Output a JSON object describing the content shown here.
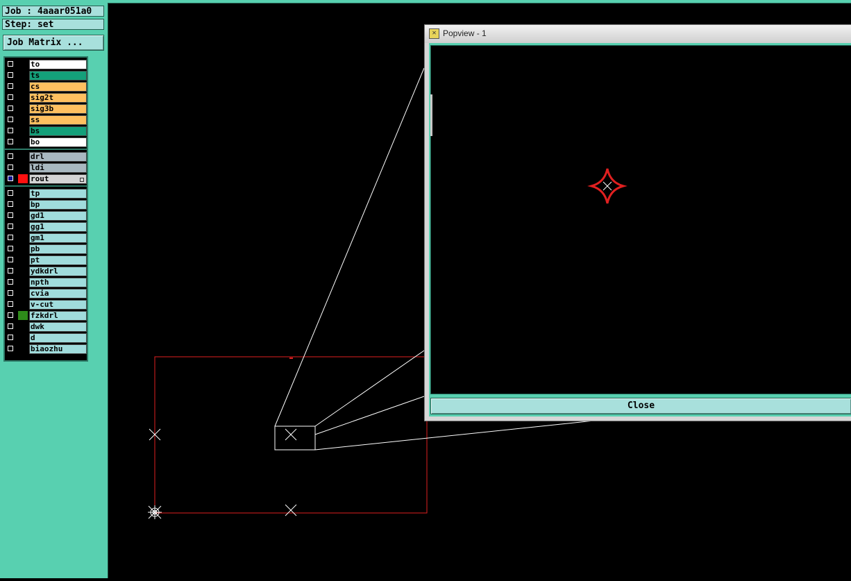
{
  "job_label": "Job : 4aaar051a0",
  "step_label": "Step: set",
  "job_matrix_button": "Job Matrix ...",
  "layer_groups": [
    [
      {
        "name": "to",
        "color": "#ffffff",
        "swatch": null,
        "selected": false
      },
      {
        "name": "ts",
        "color": "#14a07a",
        "swatch": null,
        "selected": false
      },
      {
        "name": "cs",
        "color": "#ffc060",
        "swatch": null,
        "selected": false
      },
      {
        "name": "sig2t",
        "color": "#ffc060",
        "swatch": null,
        "selected": false
      },
      {
        "name": "sig3b",
        "color": "#ffc060",
        "swatch": null,
        "selected": false
      },
      {
        "name": "ss",
        "color": "#ffc060",
        "swatch": null,
        "selected": false
      },
      {
        "name": "bs",
        "color": "#14a07a",
        "swatch": null,
        "selected": false
      },
      {
        "name": "bo",
        "color": "#ffffff",
        "swatch": null,
        "selected": false
      }
    ],
    [
      {
        "name": "drl",
        "color": "#a8b8c0",
        "swatch": null,
        "selected": false
      },
      {
        "name": "ldi",
        "color": "#a8b8c0",
        "swatch": null,
        "selected": false
      },
      {
        "name": "rout",
        "color": "#d4d4d4",
        "swatch": "#ff1010",
        "selected": true,
        "dot": true
      }
    ],
    [
      {
        "name": "tp",
        "color": "#a0dcdc",
        "swatch": null,
        "selected": false
      },
      {
        "name": "bp",
        "color": "#a0dcdc",
        "swatch": null,
        "selected": false
      },
      {
        "name": "gd1",
        "color": "#a0dcdc",
        "swatch": null,
        "selected": false
      },
      {
        "name": "gg1",
        "color": "#a0dcdc",
        "swatch": null,
        "selected": false
      },
      {
        "name": "gm1",
        "color": "#a0dcdc",
        "swatch": null,
        "selected": false
      },
      {
        "name": "pb",
        "color": "#a0dcdc",
        "swatch": null,
        "selected": false
      },
      {
        "name": "pt",
        "color": "#a0dcdc",
        "swatch": null,
        "selected": false
      },
      {
        "name": "ydkdrl",
        "color": "#a0dcdc",
        "swatch": null,
        "selected": false
      },
      {
        "name": "npth",
        "color": "#a0dcdc",
        "swatch": null,
        "selected": false
      },
      {
        "name": "cvia",
        "color": "#a0dcdc",
        "swatch": null,
        "selected": false
      },
      {
        "name": "v-cut",
        "color": "#a0dcdc",
        "swatch": null,
        "selected": false
      },
      {
        "name": "fzkdrl",
        "color": "#a0dcdc",
        "swatch": "#2e8b1a",
        "selected": false
      },
      {
        "name": "dwk",
        "color": "#a0dcdc",
        "swatch": null,
        "selected": false
      },
      {
        "name": "d",
        "color": "#a0dcdc",
        "swatch": null,
        "selected": false
      },
      {
        "name": "biaozhu",
        "color": "#a0dcdc",
        "swatch": null,
        "selected": false
      }
    ]
  ],
  "popup": {
    "title": "Popview - 1",
    "close_label": "Close",
    "icon": "popview-window-icon"
  },
  "colors": {
    "panel": "#58d0b0",
    "button": "#a8e0dc",
    "rout_outline": "#e02020",
    "guide_lines": "#ffffff"
  }
}
